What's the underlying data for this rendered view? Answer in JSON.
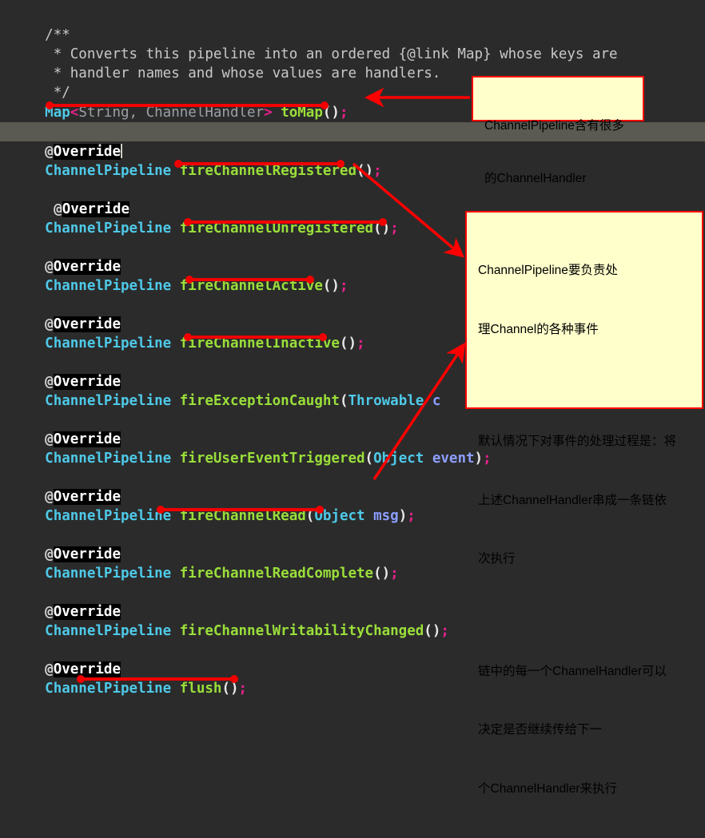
{
  "editor": {
    "theme": {
      "background": "#2b2b2b",
      "current_line_background": "#5a5a52",
      "type_color": "#4ec9e8",
      "method_color": "#9ade3a",
      "semicolon_color": "#e8218c",
      "comment_color": "#c8c8c8",
      "annotation_highlight_background": "#000000",
      "annotation_text_color": "#ffffff",
      "marker_red": "#f20000",
      "note_background": "#ffffcc",
      "note_border": "#ff0000"
    },
    "comment": {
      "l1": "/**",
      "l2": " * Converts this pipeline into an ordered {@link Map} whose keys are",
      "l3": " * handler names and whose values are handlers.",
      "l4": " */"
    },
    "signature": {
      "map": "Map",
      "generics_open": "<",
      "generics": "String, ChannelHandler",
      "generics_close": ">",
      "space": " ",
      "name": "toMap",
      "parens": "()",
      "semi": ";"
    },
    "annotation_label": "@Override",
    "annotation_at": "@",
    "annotation_word": "Override",
    "return_type": "ChannelPipeline",
    "methods": [
      {
        "name": "fireChannelRegistered",
        "params": "",
        "underline": true
      },
      {
        "name": "fireChannelUnregistered",
        "params": "",
        "underline": true
      },
      {
        "name": "fireChannelActive",
        "params": "",
        "underline": true
      },
      {
        "name": "fireChannelInactive",
        "params": "",
        "underline": true
      },
      {
        "name": "fireExceptionCaught",
        "params": "Throwable c",
        "underline": false
      },
      {
        "name": "fireUserEventTriggered",
        "params": "Object event",
        "underline": false
      },
      {
        "name": "fireChannelRead",
        "params": "Object msg",
        "underline": true
      },
      {
        "name": "fireChannelReadComplete",
        "params": "",
        "underline": false
      },
      {
        "name": "fireChannelWritabilityChanged",
        "params": "",
        "underline": false
      },
      {
        "name": "flush",
        "params": "",
        "underline": true
      }
    ],
    "param_types": {
      "throwable": "Throwable",
      "throwable_var": "c",
      "object": "Object",
      "event_var": "event",
      "msg_var": "msg"
    }
  },
  "notes": [
    {
      "id": "note-top",
      "line1": "ChannelPipeline含有很多",
      "line2": "的ChannelHandler"
    },
    {
      "id": "note-main",
      "para1_line1": "ChannelPipeline要负责处",
      "para1_line2": "理Channel的各种事件",
      "para2_line1": "默认情况下对事件的处理过程是：将",
      "para2_line2": "上述ChannelHandler串成一条链依",
      "para2_line3": "次执行",
      "para3_line1": "链中的每一个ChannelHandler可以",
      "para3_line2": "决定是否继续传给下一",
      "para3_line3": "个ChannelHandler来执行"
    }
  ]
}
